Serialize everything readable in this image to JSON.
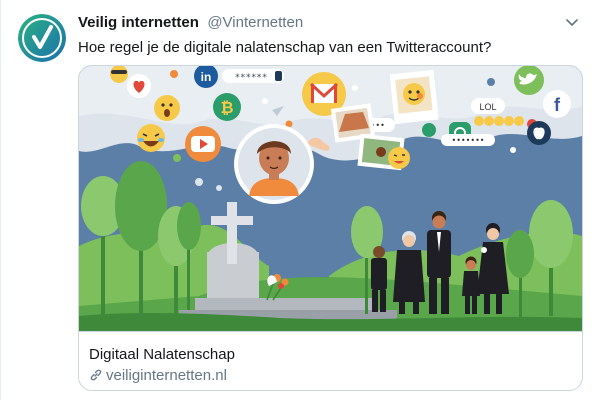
{
  "tweet": {
    "author_name": "Veilig internetten",
    "author_handle": "@Vinternetten",
    "text": "Hoe regel je de digitale nalatenschap van een Twitteraccount?"
  },
  "card": {
    "title": "Digitaal Nalatenschap",
    "domain": "veiliginternetten.nl",
    "password_mask": "******",
    "lol_label": "LOL",
    "linkedin_label": "in",
    "bubble_mask": "•••••••",
    "speech_mask": "•••••"
  },
  "colors": {
    "brand_green": "#1e9a6f",
    "sky_blue": "#5b7fa6",
    "cloud_gray": "#dde4ec",
    "grass_green": "#7dbf5a"
  },
  "icons": [
    "verified-checkmark-logo",
    "chevron-down-icon",
    "link-icon",
    "heart-icon",
    "linkedin-icon",
    "bitcoin-icon",
    "gmail-icon",
    "youtube-icon",
    "twitter-icon",
    "facebook-icon",
    "apple-icon",
    "instagram-icon",
    "like-icon"
  ]
}
